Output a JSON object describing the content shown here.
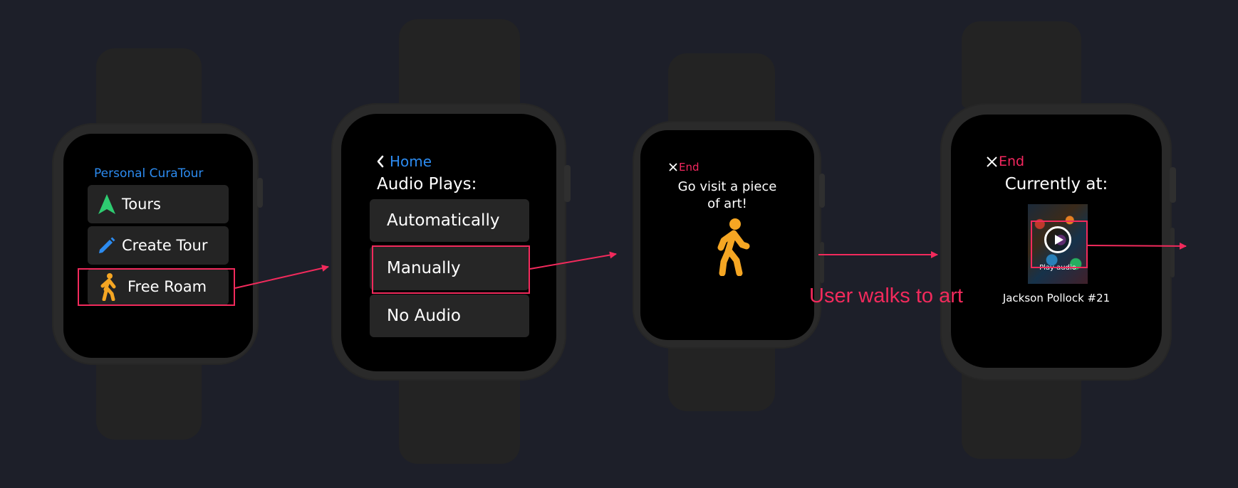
{
  "screens": {
    "home": {
      "app_title": "Personal CuraTour",
      "items": [
        {
          "label": "Tours",
          "icon": "navigation-arrow-icon",
          "icon_color": "#2ecc71"
        },
        {
          "label": "Create Tour",
          "icon": "pencil-icon",
          "icon_color": "#2c8bf0"
        },
        {
          "label": "Free Roam",
          "icon": "walking-person-icon",
          "icon_color": "#f5a623"
        }
      ]
    },
    "audio": {
      "back_label": "Home",
      "heading": "Audio Plays:",
      "options": [
        "Automatically",
        "Manually",
        "No Audio"
      ]
    },
    "roam": {
      "end_label": "End",
      "message": "Go visit a piece of art!",
      "icon": "walking-person-icon"
    },
    "current": {
      "end_label": "End",
      "heading": "Currently at:",
      "play_label": "Play audio",
      "artwork_title": "Jackson Pollock #21"
    }
  },
  "annotations": {
    "walk_caption": "User walks to art"
  },
  "colors": {
    "background": "#1d1f29",
    "accent_blue": "#2c8bf0",
    "highlight_red": "#f22a5c",
    "end_red": "#f4275f",
    "walker_orange": "#f5a623"
  }
}
